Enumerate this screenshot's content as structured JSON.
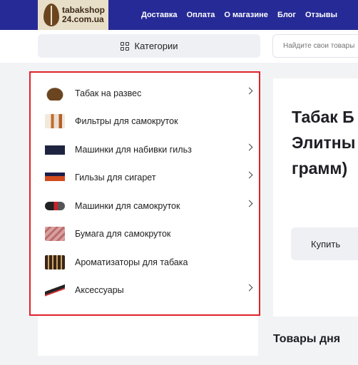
{
  "header": {
    "logo": {
      "line1": "tabakshop",
      "line2": "24.com.ua"
    },
    "nav": [
      "Доставка",
      "Оплата",
      "О магазине",
      "Блог",
      "Отзывы"
    ]
  },
  "subbar": {
    "categories_label": "Категории",
    "search_placeholder": "Найдите свои товары"
  },
  "categories": [
    {
      "label": "Табак на развес",
      "has_submenu": true,
      "icon": "tobacco-thumb"
    },
    {
      "label": "Фильтры для самокруток",
      "has_submenu": false,
      "icon": "filters-thumb"
    },
    {
      "label": "Машинки для набивки гильз",
      "has_submenu": true,
      "icon": "injector-thumb"
    },
    {
      "label": "Гильзы для сигарет",
      "has_submenu": true,
      "icon": "tubes-thumb"
    },
    {
      "label": "Машинки для самокруток",
      "has_submenu": true,
      "icon": "roller-thumb"
    },
    {
      "label": "Бумага для самокруток",
      "has_submenu": false,
      "icon": "papers-thumb"
    },
    {
      "label": "Ароматизаторы для табака",
      "has_submenu": false,
      "icon": "flavors-thumb"
    },
    {
      "label": "Аксессуары",
      "has_submenu": true,
      "icon": "accessories-thumb"
    }
  ],
  "product": {
    "title": "Табак Б\nЭлитны\nграмм)",
    "buy_label": "Купить"
  },
  "deals": {
    "title": "Товары дня"
  },
  "colors": {
    "header_bg": "#262a96",
    "highlight_border": "#e0222a",
    "logo_bg": "#e8dfc9"
  }
}
